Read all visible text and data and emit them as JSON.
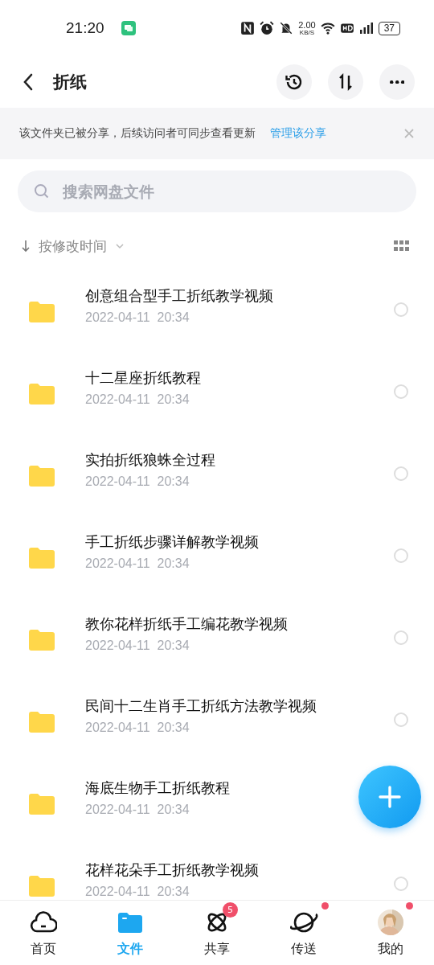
{
  "status_bar": {
    "time": "21:20",
    "net_speed": "2.00",
    "net_unit": "KB/S",
    "battery": "37"
  },
  "header": {
    "title": "折纸"
  },
  "share_banner": {
    "text": "该文件夹已被分享，后续访问者可同步查看更新",
    "link": "管理该分享"
  },
  "search": {
    "placeholder": "搜索网盘文件"
  },
  "sort": {
    "label": "按修改时间"
  },
  "files": [
    {
      "name": "创意组合型手工折纸教学视频",
      "date": "2022-04-11  20:34",
      "selected": false
    },
    {
      "name": "十二星座折纸教程",
      "date": "2022-04-11  20:34",
      "selected": false
    },
    {
      "name": "实拍折纸狼蛛全过程",
      "date": "2022-04-11  20:34",
      "selected": false
    },
    {
      "name": "手工折纸步骤详解教学视频",
      "date": "2022-04-11  20:34",
      "selected": false
    },
    {
      "name": "教你花样折纸手工编花教学视频",
      "date": "2022-04-11  20:34",
      "selected": false
    },
    {
      "name": "民间十二生肖手工折纸方法教学视频",
      "date": "2022-04-11  20:34",
      "selected": false
    },
    {
      "name": "海底生物手工折纸教程",
      "date": "2022-04-11  20:34"
    },
    {
      "name": "花样花朵手工折纸教学视频",
      "date": "2022-04-11  20:34",
      "selected": false
    }
  ],
  "nav": [
    {
      "kind": "cloud",
      "label": "首页",
      "selected": false
    },
    {
      "kind": "folder",
      "label": "文件",
      "selected": true
    },
    {
      "kind": "atom",
      "label": "共享",
      "selected": false,
      "badge": "5"
    },
    {
      "kind": "planet",
      "label": "传送",
      "selected": false,
      "dot": true
    },
    {
      "kind": "avatar",
      "label": "我的",
      "selected": false,
      "dot": true
    }
  ]
}
